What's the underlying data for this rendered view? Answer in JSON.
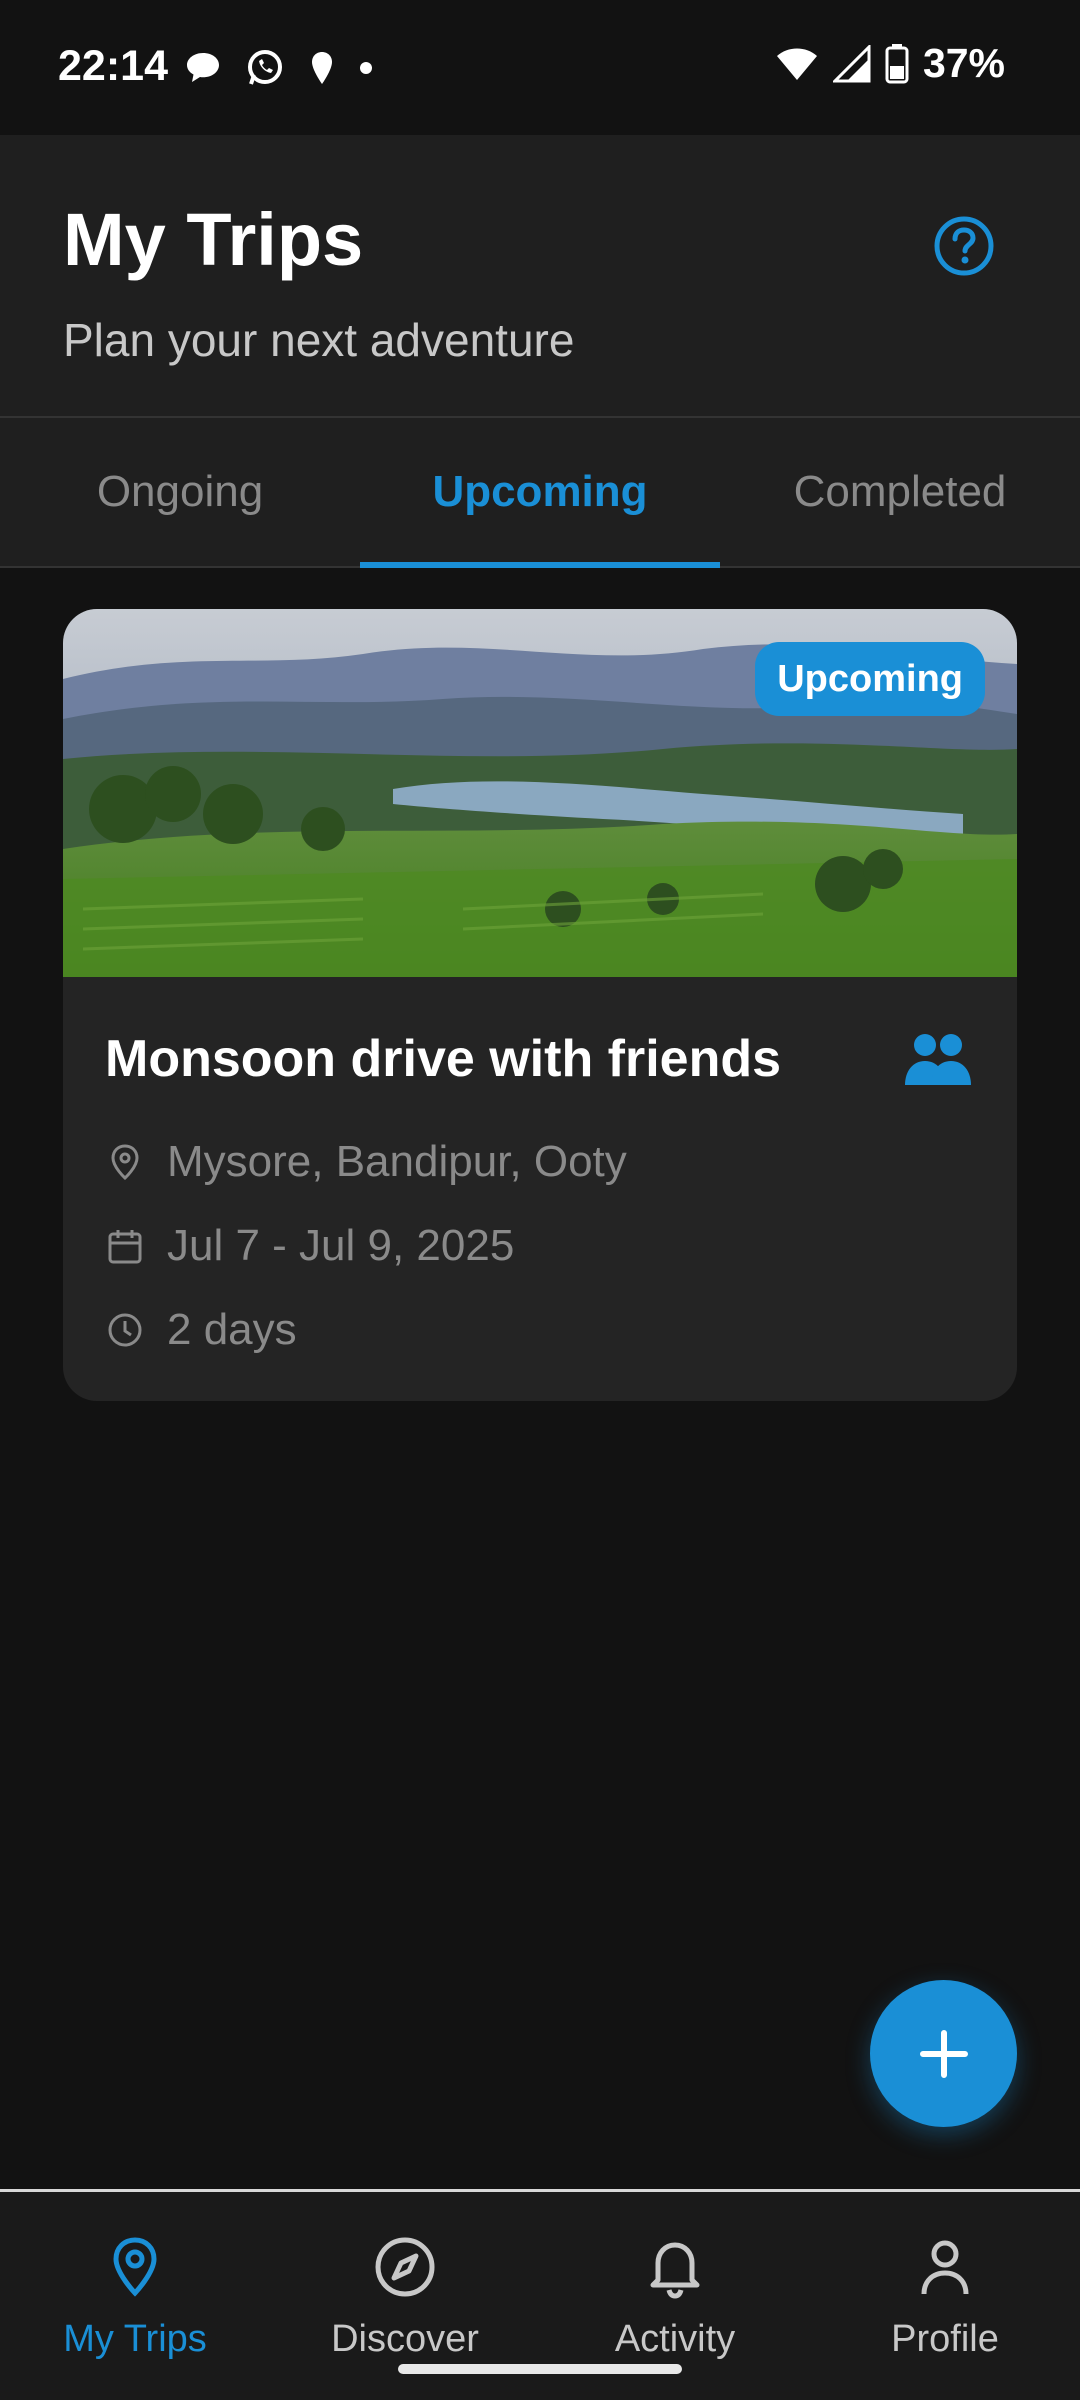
{
  "status_bar": {
    "time": "22:14",
    "battery": "37%",
    "icons": [
      "chat-bubble-icon",
      "whatsapp-icon",
      "location-pin-icon",
      "dot-icon",
      "wifi-icon",
      "signal-icon",
      "battery-icon"
    ]
  },
  "header": {
    "title": "My Trips",
    "subtitle": "Plan your next adventure",
    "help_icon": "help-circle-icon"
  },
  "tabs": [
    {
      "label": "Ongoing",
      "active": false
    },
    {
      "label": "Upcoming",
      "active": true
    },
    {
      "label": "Completed",
      "active": false
    }
  ],
  "trip_card": {
    "badge": "Upcoming",
    "title": "Monsoon drive with friends",
    "group_icon": "group-icon",
    "location": "Mysore, Bandipur, Ooty",
    "dates": "Jul 7 - Jul 9, 2025",
    "duration": "2 days"
  },
  "fab": {
    "icon": "plus-icon"
  },
  "bottom_nav": [
    {
      "label": "My Trips",
      "icon": "location-pin-icon",
      "active": true
    },
    {
      "label": "Discover",
      "icon": "compass-icon",
      "active": false
    },
    {
      "label": "Activity",
      "icon": "bell-icon",
      "active": false
    },
    {
      "label": "Profile",
      "icon": "person-icon",
      "active": false
    }
  ],
  "colors": {
    "accent": "#1a8fd6",
    "background": "#121212",
    "surface": "#1f1f1f",
    "card": "#242424",
    "muted_text": "#8a8a8a"
  }
}
